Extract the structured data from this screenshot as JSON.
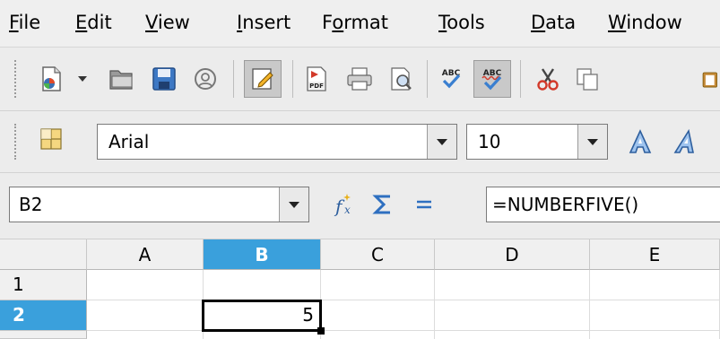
{
  "menu": [
    "File",
    "Edit",
    "View",
    "Insert",
    "Format",
    "Tools",
    "Data",
    "Window"
  ],
  "toolbar1": {
    "buttons": [
      "new-document-icon",
      "dropdown-arrow-icon",
      "open-folder-icon",
      "save-icon",
      "edit-file-icon",
      "edit-mode-icon",
      "export-pdf-icon",
      "print-icon",
      "page-preview-icon",
      "spellcheck-icon",
      "autospellcheck-icon",
      "cut-icon",
      "copy-icon",
      "paste-icon"
    ]
  },
  "toolbar2": {
    "font_name": "Arial",
    "font_size": "10"
  },
  "formula_bar": {
    "name_box": "B2",
    "formula": "=NUMBERFIVE()"
  },
  "sheet": {
    "columns": [
      "A",
      "B",
      "C",
      "D",
      "E"
    ],
    "selected_column": "B",
    "rows": [
      "1",
      "2"
    ],
    "selected_row": "2",
    "b2_value": "5"
  },
  "colors": {
    "selection_header": "#3aa0dc",
    "active_cell_border": "#000000"
  }
}
